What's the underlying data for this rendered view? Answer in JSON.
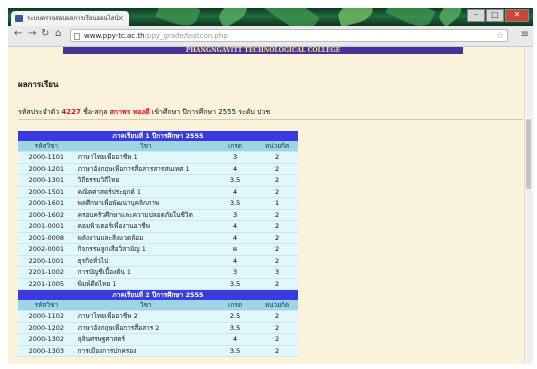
{
  "browser": {
    "tab_title": "ระบบตรวจสอบผลการเรียนออนไลน์",
    "address_host": "www.ppy-tc.ac.th",
    "address_path": "/ppy_grade/testcon.php",
    "window_controls": [
      "–",
      "□",
      "✕"
    ]
  },
  "page": {
    "banner": "PHANGNGAVITT TECHNOLOGICAL COLLEGE",
    "heading": "ผลการเรียน",
    "student": {
      "prefix": "รหัสประจำตัว",
      "id": "4227",
      "name_label": "ชื่อ-สกุล",
      "name": "สกาพร ทองดี",
      "suffix": "เข้าศึกษา ปีการศึกษา 2555 ระดับ ปวช"
    }
  },
  "grades": {
    "headers": [
      "รหัสวิชา",
      "วิชา",
      "เกรด",
      "หน่วยกิต"
    ],
    "semesters": [
      {
        "title": "ภาคเรียนที่ 1 ปีการศึกษา 2555",
        "rows": [
          [
            "2000-1101",
            "ภาษาไทยเพื่ออาชีพ 1",
            "3",
            "2"
          ],
          [
            "2000-1201",
            "ภาษาอังกฤษเพื่อการสื่อสารสารสนเทศ 1",
            "4",
            "2"
          ],
          [
            "2000-1301",
            "วิถีธรรมวิถีไทย",
            "3.5",
            "2"
          ],
          [
            "2000-1501",
            "คณิตศาสตร์ประยุกต์ 1",
            "4",
            "2"
          ],
          [
            "2000-1601",
            "พลศึกษาเพื่อพัฒนาบุคลิกภาพ",
            "3.5",
            "1"
          ],
          [
            "2000-1602",
            "ครอบครัวศึกษาและความปลอดภัยในชีวิต",
            "3",
            "2"
          ],
          [
            "2001-0001",
            "คอมพิวเตอร์เพื่องานอาชีพ",
            "4",
            "2"
          ],
          [
            "2001-0008",
            "พลังงานและสิ่งแวดล้อม",
            "4",
            "2"
          ],
          [
            "2002-0001",
            "กิจกรรมลูกเสือวิสามัญ 1",
            "ผ",
            "2"
          ],
          [
            "2200-1001",
            "ธุรกิจทั่วไป",
            "4",
            "2"
          ],
          [
            "2201-1002",
            "การบัญชีเบื้องต้น 1",
            "3",
            "3"
          ],
          [
            "2201-1005",
            "พิมพ์ดีดไทย 1",
            "3.5",
            "2"
          ]
        ]
      },
      {
        "title": "ภาคเรียนที่ 2 ปีการศึกษา 2555",
        "rows": [
          [
            "2000-1102",
            "ภาษาไทยเพื่ออาชีพ 2",
            "2.5",
            "2"
          ],
          [
            "2000-1202",
            "ภาษาอังกฤษเพื่อการสื่อสาร 2",
            "3.5",
            "2"
          ],
          [
            "2000-1302",
            "ลุลินศรษฐศาสตร์",
            "4",
            "2"
          ],
          [
            "2000-1303",
            "การเมืองการปกครอง",
            "3.5",
            "2"
          ]
        ]
      }
    ]
  },
  "colors": {
    "semester_header_bg": "#3a3ae0",
    "column_header_bg": "#9ed5e4",
    "row_bg": "#e0f7fb",
    "page_bg": "#fbf2dc",
    "highlight_text": "#e01818"
  }
}
